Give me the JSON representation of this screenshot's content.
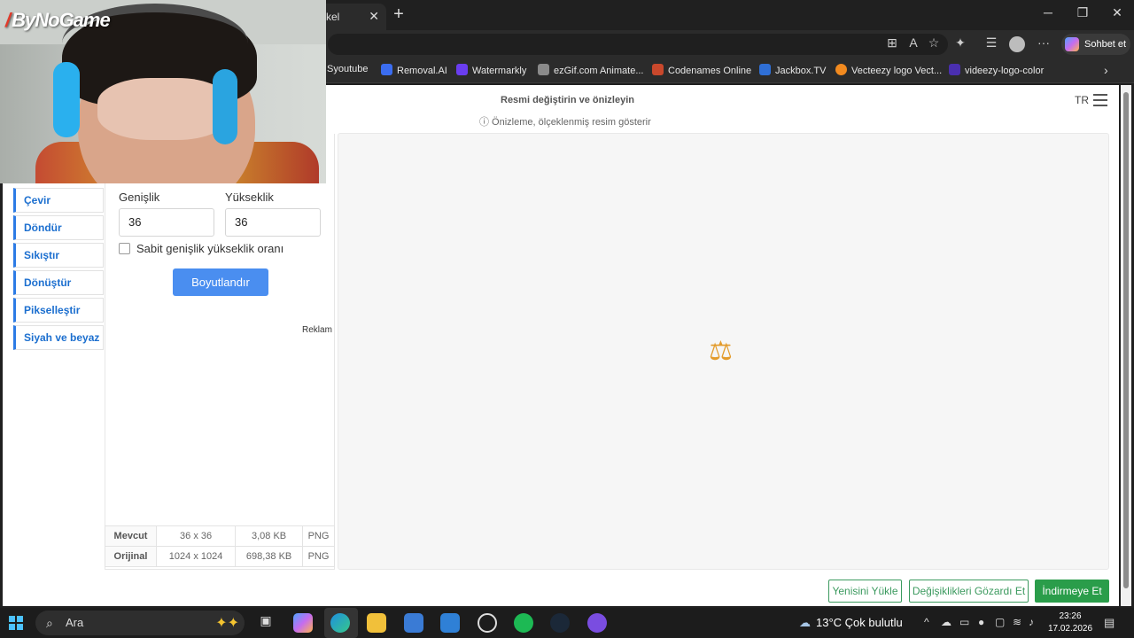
{
  "browser": {
    "tab_title": "kel",
    "sohbet_label": "Sohbet et",
    "bookmarks": [
      {
        "label": "Syoutube",
        "color": "#2b2b2b"
      },
      {
        "label": "Removal.AI",
        "color": "#3b6df0"
      },
      {
        "label": "Watermarkly",
        "color": "#6a3df0"
      },
      {
        "label": "ezGif.com Animate...",
        "color": "#8a8a8a"
      },
      {
        "label": "Codenames Online",
        "color": "#c9482c"
      },
      {
        "label": "Jackbox.TV",
        "color": "#2f6fd6"
      },
      {
        "label": "Vecteezy logo Vect...",
        "color": "#f28a1f"
      },
      {
        "label": "videezy-logo-color",
        "color": "#4a2fb0"
      }
    ]
  },
  "webcam": {
    "overlay_logo": "ByNoGame"
  },
  "page": {
    "header_title": "Resmi değiştirin ve önizleyin",
    "header_subtitle": "ⓘ Önizleme, ölçeklenmiş resim gösterir",
    "lang": "TR",
    "sidebar": [
      "Çevir",
      "Döndür",
      "Sıkıştır",
      "Dönüştür",
      "Pikselleştir",
      "Siyah ve beyaz"
    ],
    "form": {
      "width_label": "Genişlik",
      "height_label": "Yükseklik",
      "width_value": "36",
      "height_value": "36",
      "aspect_label": "Sabit genişlik yükseklik oranı",
      "resize_button": "Boyutlandır",
      "ad_label": "Reklam"
    },
    "info_table": [
      {
        "row": "Mevcut",
        "dims": "36 x 36",
        "size": "3,08 KB",
        "format": "PNG"
      },
      {
        "row": "Orijinal",
        "dims": "1024 x 1024",
        "size": "698,38 KB",
        "format": "PNG"
      }
    ],
    "preview_icon": "⚖",
    "actions": {
      "upload_new": "Yenisini Yükle",
      "discard": "Değişiklikleri Gözardı Et",
      "download": "İndirmeye Et"
    }
  },
  "taskbar": {
    "search_label": "Ara",
    "weather": "13°C  Çok bulutlu",
    "time": "23:26",
    "date": "17.02.2026"
  }
}
